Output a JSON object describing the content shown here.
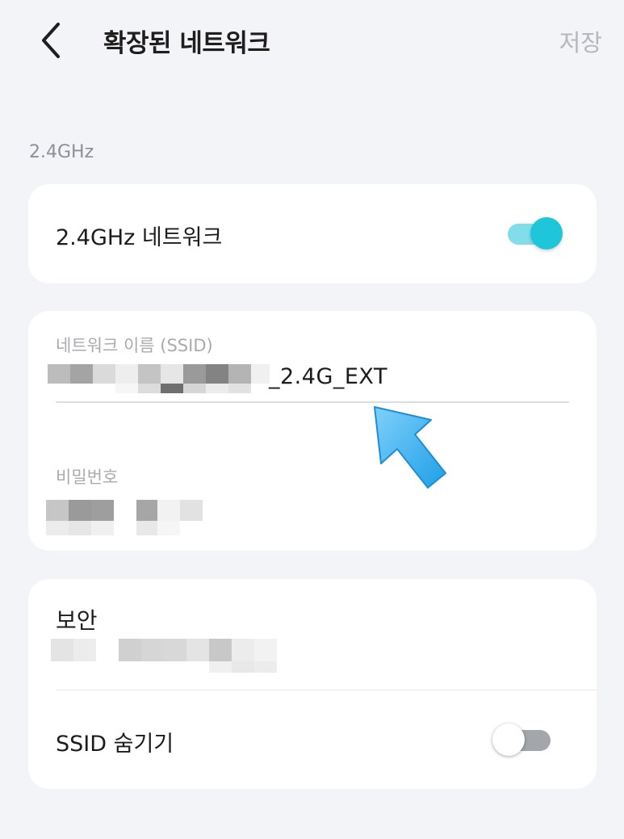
{
  "header": {
    "back_icon": "chevron-left-icon",
    "title": "확장된 네트워크",
    "save_label": "저장"
  },
  "section_label": "2.4GHz",
  "network_toggle": {
    "label": "2.4GHz 네트워크",
    "enabled": true
  },
  "ssid": {
    "label": "네트워크 이름 (SSID)",
    "value_suffix": "_2.4G_EXT",
    "value_prefix_obscured": true
  },
  "password": {
    "label": "비밀번호",
    "value_obscured": true
  },
  "security": {
    "label": "보안",
    "value_obscured": true
  },
  "hide_ssid": {
    "label": "SSID 숨기기",
    "enabled": false
  },
  "annotation": {
    "icon": "arrow-pointer-icon",
    "color": "#29a9ee"
  },
  "colors": {
    "accent": "#1fc6d9",
    "background": "#f3f4f8",
    "card": "#ffffff"
  }
}
